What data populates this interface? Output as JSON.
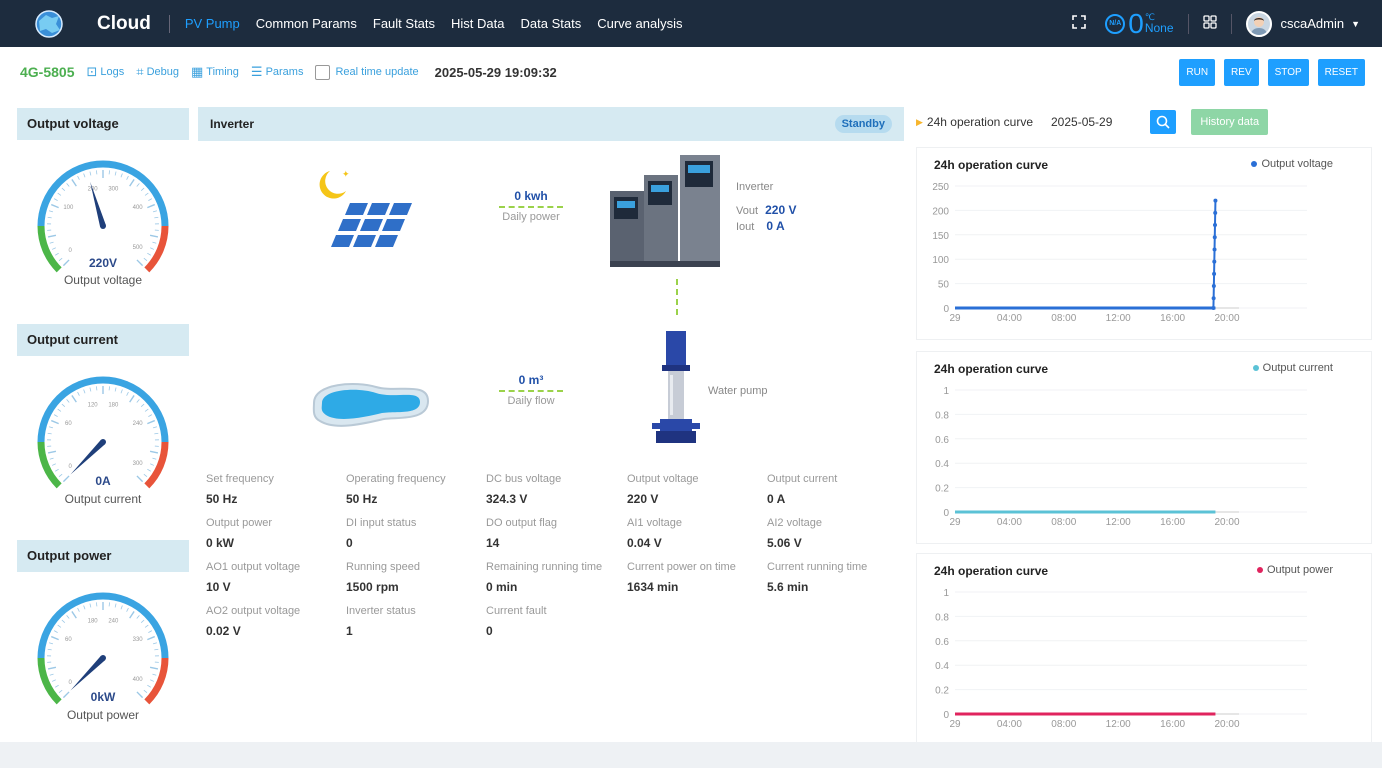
{
  "topbar": {
    "brand": "Cloud",
    "nav": [
      "PV Pump",
      "Common Params",
      "Fault Stats",
      "Hist Data",
      "Data Stats",
      "Curve analysis"
    ],
    "active_nav": "PV Pump",
    "na_badge": "N/A",
    "temperature_value": "0",
    "temperature_unit": "℃",
    "temperature_status": "None",
    "username": "cscaAdmin",
    "icons": [
      "globe-logo-icon",
      "fullscreen-icon",
      "apps-grid-icon",
      "chevron-down-icon"
    ]
  },
  "toolbar": {
    "device_id": "4G-5805",
    "logs": "Logs",
    "debug": "Debug",
    "timing": "Timing",
    "params": "Params",
    "realtime_label": "Real time update",
    "timestamp": "2025-05-29 19:09:32",
    "buttons": [
      "RUN",
      "REV",
      "STOP",
      "RESET"
    ]
  },
  "gauges": [
    {
      "title": "Output voltage",
      "value": "220V",
      "label": "Output voltage",
      "ticks": [
        "200",
        "300",
        "100",
        "400",
        "0",
        "500"
      ],
      "fraction": 0.44
    },
    {
      "title": "Output current",
      "value": "0A",
      "label": "Output current",
      "ticks": [
        "120",
        "180",
        "60",
        "240",
        "0",
        "300"
      ],
      "fraction": 0.0
    },
    {
      "title": "Output power",
      "value": "0kW",
      "label": "Output power",
      "ticks": [
        "180",
        "240",
        "60",
        "330",
        "0",
        "400"
      ],
      "fraction": 0.0
    }
  ],
  "center": {
    "title": "Inverter",
    "status": "Standby",
    "daily_power_value": "0 kwh",
    "daily_power_label": "Daily power",
    "daily_flow_value": "0 m³",
    "daily_flow_label": "Daily flow",
    "inverter_label": "Inverter",
    "vout_label": "Vout",
    "vout_value": "220 V",
    "iout_label": "Iout",
    "iout_value": "0 A",
    "pump_label": "Water pump"
  },
  "params": [
    {
      "name": "Set frequency",
      "value": "50 Hz"
    },
    {
      "name": "Operating frequency",
      "value": "50 Hz"
    },
    {
      "name": "DC bus voltage",
      "value": "324.3 V"
    },
    {
      "name": "Output voltage",
      "value": "220 V"
    },
    {
      "name": "Output current",
      "value": "0 A"
    },
    {
      "name": "Output power",
      "value": "0 kW"
    },
    {
      "name": "DI input status",
      "value": "0"
    },
    {
      "name": "DO output flag",
      "value": "14"
    },
    {
      "name": "AI1 voltage",
      "value": "0.04 V"
    },
    {
      "name": "AI2 voltage",
      "value": "5.06 V"
    },
    {
      "name": "AO1 output voltage",
      "value": "10 V"
    },
    {
      "name": "Running speed",
      "value": "1500 rpm"
    },
    {
      "name": "Remaining running time",
      "value": "0 min"
    },
    {
      "name": "Current power on time",
      "value": "1634 min"
    },
    {
      "name": "Current running time",
      "value": "5.6 min"
    },
    {
      "name": "AO2 output voltage",
      "value": "0.02 V"
    },
    {
      "name": "Inverter status",
      "value": "1"
    },
    {
      "name": "Current fault",
      "value": "0"
    }
  ],
  "curve_header": {
    "title": "24h operation curve",
    "date": "2025-05-29",
    "history_button": "History data"
  },
  "chart_data": [
    {
      "type": "line",
      "title": "24h operation curve",
      "series": [
        {
          "name": "Output voltage",
          "color": "#2a6fd6",
          "x": [
            "29",
            "19:00",
            "19:01",
            "19:02",
            "19:03",
            "19:04",
            "19:05",
            "19:06",
            "19:07",
            "19:08",
            "19:09"
          ],
          "values": [
            0,
            0,
            20,
            45,
            70,
            95,
            120,
            145,
            170,
            195,
            220
          ]
        }
      ],
      "x_ticks": [
        "29",
        "04:00",
        "08:00",
        "12:00",
        "16:00",
        "20:00"
      ],
      "y_ticks": [
        "0",
        "50",
        "100",
        "150",
        "200",
        "250"
      ],
      "ylim": [
        0,
        250
      ]
    },
    {
      "type": "line",
      "title": "24h operation curve",
      "series": [
        {
          "name": "Output current",
          "color": "#5bc2d6",
          "x": [
            "29",
            "19:09"
          ],
          "values": [
            0,
            0
          ]
        }
      ],
      "x_ticks": [
        "29",
        "04:00",
        "08:00",
        "12:00",
        "16:00",
        "20:00"
      ],
      "y_ticks": [
        "0",
        "0.2",
        "0.4",
        "0.6",
        "0.8",
        "1"
      ],
      "ylim": [
        0,
        1
      ]
    },
    {
      "type": "line",
      "title": "24h operation curve",
      "series": [
        {
          "name": "Output power",
          "color": "#e0245e",
          "x": [
            "29",
            "19:09"
          ],
          "values": [
            0,
            0
          ]
        }
      ],
      "x_ticks": [
        "29",
        "04:00",
        "08:00",
        "12:00",
        "16:00",
        "20:00"
      ],
      "y_ticks": [
        "0",
        "0.2",
        "0.4",
        "0.6",
        "0.8",
        "1"
      ],
      "ylim": [
        0,
        1
      ]
    }
  ]
}
